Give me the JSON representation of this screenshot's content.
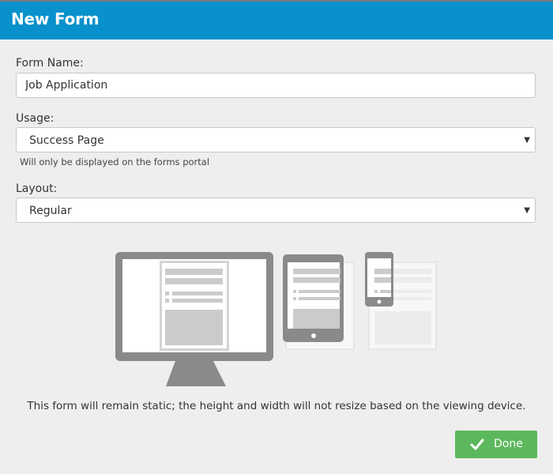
{
  "dialog": {
    "title": "New Form"
  },
  "form_name": {
    "label": "Form Name:",
    "value": "Job Application"
  },
  "usage": {
    "label": "Usage:",
    "selected": "Success Page",
    "helper": "Will only be displayed on the forms portal"
  },
  "layout": {
    "label": "Layout:",
    "selected": "Regular"
  },
  "illustration": {
    "devices": [
      "desktop-monitor-icon",
      "tablet-icon",
      "phone-icon"
    ]
  },
  "note": "This form will remain static; the height and width will not resize based on the viewing device.",
  "actions": {
    "done_label": "Done",
    "done_icon": "check-icon"
  },
  "colors": {
    "header": "#0891cc",
    "done_button": "#5cb85c",
    "device_gray": "#8a8a8a"
  }
}
